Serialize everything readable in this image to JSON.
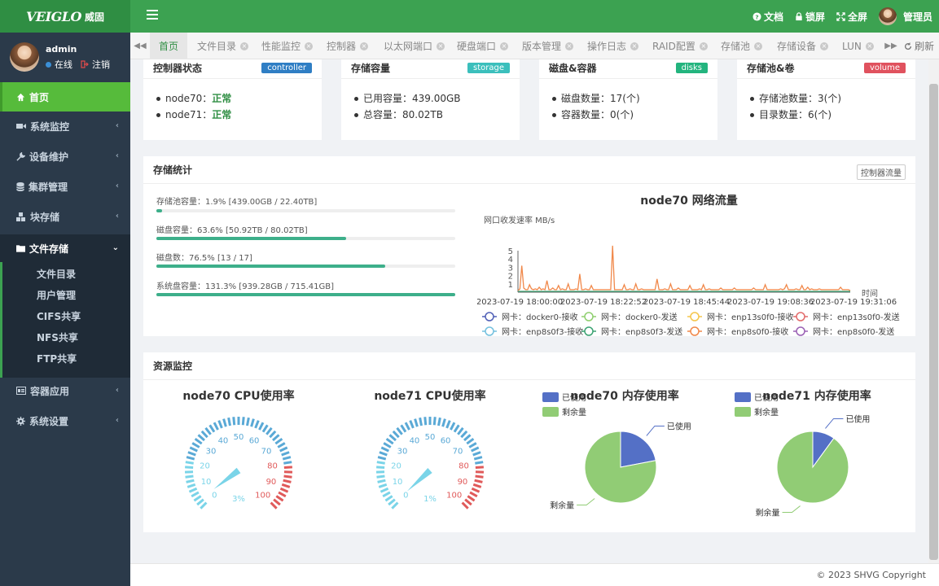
{
  "brand": {
    "logo_text": "VEIGLO",
    "logo_cn": "威固"
  },
  "topbar": {
    "docs": "文档",
    "lock": "锁屏",
    "fullscreen": "全屏",
    "user": "管理员",
    "icons": [
      "question-circle-icon",
      "lock-icon",
      "expand-icon",
      "menu-icon"
    ]
  },
  "sidebar": {
    "user": {
      "name": "admin",
      "status_online": "在线",
      "logout": "注销"
    },
    "home": "首页",
    "items": [
      {
        "label": "系统监控",
        "icon": "video-icon"
      },
      {
        "label": "设备维护",
        "icon": "wrench-icon"
      },
      {
        "label": "集群管理",
        "icon": "database-icon"
      },
      {
        "label": "块存储",
        "icon": "cubes-icon"
      },
      {
        "label": "文件存储",
        "icon": "folder-icon"
      },
      {
        "label": "容器应用",
        "icon": "container-icon"
      },
      {
        "label": "系统设置",
        "icon": "gear-icon"
      }
    ],
    "file_storage_sub": [
      "文件目录",
      "用户管理",
      "CIFS共享",
      "NFS共享",
      "FTP共享"
    ]
  },
  "tabs": [
    "首页",
    "文件目录",
    "性能监控",
    "控制器",
    "以太网端口",
    "硬盘端口",
    "版本管理",
    "操作日志",
    "RAID配置",
    "存储池",
    "存储设备",
    "LUN"
  ],
  "refresh": "刷新",
  "cards": [
    {
      "title": "控制器状态",
      "badge": "controller",
      "badge_color": "#2f7ec4",
      "lines": [
        {
          "k": "node70：",
          "v": "正常"
        },
        {
          "k": "node71：",
          "v": "正常"
        }
      ]
    },
    {
      "title": "存储容量",
      "badge": "storage",
      "badge_color": "#3bbfbc",
      "lines": [
        {
          "k": "已用容量：",
          "v": "439.00GB"
        },
        {
          "k": "总容量：",
          "v": "80.02TB"
        }
      ]
    },
    {
      "title": "磁盘&容器",
      "badge": "disks",
      "badge_color": "#23b47e",
      "lines": [
        {
          "k": "磁盘数量：",
          "v": "17(个)"
        },
        {
          "k": "容器数量：",
          "v": "0(个)"
        }
      ]
    },
    {
      "title": "存储池&卷",
      "badge": "volume",
      "badge_color": "#e0525e",
      "lines": [
        {
          "k": "存储池数量：",
          "v": "3(个)"
        },
        {
          "k": "目录数量：",
          "v": "6(个)"
        }
      ]
    }
  ],
  "storage_stats": {
    "title": "存储统计",
    "button": "控制器流量",
    "bars": [
      {
        "label": "存储池容量：1.9% [439.00GB / 22.40TB]",
        "pct": 1.9
      },
      {
        "label": "磁盘容量：63.6% [50.92TB / 80.02TB]",
        "pct": 63.6
      },
      {
        "label": "磁盘数：76.5% [13 / 17]",
        "pct": 76.5
      },
      {
        "label": "系统盘容量：131.3% [939.28GB / 715.41GB]",
        "pct": 100
      }
    ]
  },
  "resource": {
    "title": "资源监控"
  },
  "footer": {
    "copyright": "© 2023 SHVG Copyright"
  },
  "chart_data": [
    {
      "type": "line",
      "title": "node70 网络流量",
      "ylabel": "网口收发速率 MB/s",
      "xlabel": "时间",
      "ylim": [
        0,
        5
      ],
      "yticks": [
        "1",
        "2",
        "3",
        "4",
        "5"
      ],
      "x_ticks": [
        "2023-07-19 18:00:00",
        "2023-07-19 18:22:52",
        "2023-07-19 18:45:44",
        "2023-07-19 19:08:36",
        "2023-07-19 19:31:06"
      ],
      "legend": [
        {
          "name": "网卡：docker0-接收",
          "color": "#4f5fb6"
        },
        {
          "name": "网卡：docker0-发送",
          "color": "#8fcf6f"
        },
        {
          "name": "网卡：enp13s0f0-接收",
          "color": "#f5c54a"
        },
        {
          "name": "网卡：enp13s0f0-发送",
          "color": "#e26a6a"
        },
        {
          "name": "网卡：enp8s0f3-接收",
          "color": "#73c0de"
        },
        {
          "name": "网卡：enp8s0f3-发送",
          "color": "#3ba272"
        },
        {
          "name": "网卡：enp8s0f0-接收",
          "color": "#f0884a"
        },
        {
          "name": "网卡：enp8s0f0-发送",
          "color": "#9a60b4"
        }
      ],
      "series": [
        {
          "name": "网卡：enp8s0f0-接收",
          "color": "#f0884a",
          "values": [
            0.2,
            0.4,
            3.2,
            0.5,
            0.3,
            0.3,
            0.9,
            0.4,
            0.3,
            0.4,
            0.3,
            0.6,
            0.3,
            0.4,
            0.3,
            1.4,
            0.3,
            0.3,
            0.5,
            0.3,
            0.3,
            0.8,
            0.3,
            0.4,
            0.3,
            0.3,
            1.0,
            0.3,
            0.3,
            0.3,
            0.4,
            0.3,
            2.2,
            0.3,
            0.3,
            0.4,
            0.3,
            0.3,
            0.8,
            0.3,
            0.3,
            0.3,
            0.3,
            0.3,
            0.3,
            0.3,
            0.3,
            0.3,
            0.3,
            5.6,
            0.3,
            0.3,
            0.3,
            0.3,
            0.3,
            0.9,
            0.3,
            0.3,
            0.4,
            0.3,
            0.3,
            1.0,
            0.3,
            0.3,
            0.4,
            0.3,
            0.3,
            0.3,
            0.3,
            0.3,
            0.3,
            0.3,
            1.6,
            0.3,
            0.3,
            0.3,
            0.4,
            0.3,
            0.3,
            1.0,
            0.3,
            0.3,
            0.3,
            0.5,
            0.3,
            0.3,
            0.3,
            0.3,
            0.3,
            0.8,
            0.3,
            0.3,
            0.3,
            0.3,
            0.4,
            0.3,
            0.9,
            0.3,
            0.3,
            0.4,
            0.3,
            0.3,
            0.3,
            0.3,
            0.3,
            0.5,
            0.3,
            0.3,
            0.3,
            0.3,
            0.3,
            0.3,
            0.5,
            0.3,
            0.3,
            0.3,
            0.3,
            0.3,
            0.3,
            0.3,
            0.3,
            0.3,
            0.5,
            0.3,
            0.3,
            0.3,
            0.3,
            0.3,
            0.9,
            0.3,
            0.3,
            0.3,
            0.3,
            0.3,
            0.3,
            0.3,
            0.4,
            0.3,
            0.4,
            0.9,
            0.3,
            0.3,
            0.3,
            0.3,
            0.4,
            0.3,
            0.3,
            0.8,
            0.3,
            0.3,
            0.6,
            0.3,
            0.4,
            0.3,
            0.3,
            0.3,
            0.4,
            0.3,
            0.3,
            0.3,
            0.3,
            0.3,
            0.3,
            0.3,
            0.3,
            0.3,
            0.3,
            0.6,
            0.3,
            0.3,
            0.3,
            0.3,
            0.2
          ]
        },
        {
          "name": "网卡：enp8s0f0-发送",
          "color": "#3ba272",
          "values": [
            0.1,
            0.1,
            0.1,
            0.1,
            0.1,
            0.1,
            0.1,
            0.1,
            0.1,
            0.1,
            0.1,
            0.1,
            0.1,
            0.1,
            0.1,
            0.1,
            0.1,
            0.1,
            0.1,
            0.1,
            0.1,
            0.1,
            0.1,
            0.1,
            0.1,
            0.1,
            0.1,
            0.1,
            0.1,
            0.1,
            0.1,
            0.1,
            0.1,
            0.1,
            0.1,
            0.1,
            0.1,
            0.1,
            0.1,
            0.1,
            0.1,
            0.1,
            0.1,
            0.1,
            0.1,
            0.1,
            0.1,
            0.1,
            0.1,
            0.1
          ]
        }
      ]
    },
    {
      "type": "gauge",
      "title": "node70 CPU使用率",
      "value": 3,
      "unit": "%",
      "min": 0,
      "max": 100,
      "ticks": [
        "0",
        "10",
        "20",
        "30",
        "40",
        "50",
        "60",
        "70",
        "80",
        "90",
        "100"
      ]
    },
    {
      "type": "gauge",
      "title": "node71 CPU使用率",
      "value": 1,
      "unit": "%",
      "min": 0,
      "max": 100,
      "ticks": [
        "0",
        "10",
        "20",
        "30",
        "40",
        "50",
        "60",
        "70",
        "80",
        "90",
        "100"
      ]
    },
    {
      "type": "pie",
      "title": "node70 内存使用率",
      "legend": [
        "已使用",
        "剩余量"
      ],
      "slices": [
        {
          "name": "已使用",
          "value": 22,
          "color": "#5470c6"
        },
        {
          "name": "剩余量",
          "value": 78,
          "color": "#91cc75"
        }
      ]
    },
    {
      "type": "pie",
      "title": "node71 内存使用率",
      "legend": [
        "已使用",
        "剩余量"
      ],
      "slices": [
        {
          "name": "已使用",
          "value": 10,
          "color": "#5470c6"
        },
        {
          "name": "剩余量",
          "value": 90,
          "color": "#91cc75"
        }
      ]
    }
  ]
}
